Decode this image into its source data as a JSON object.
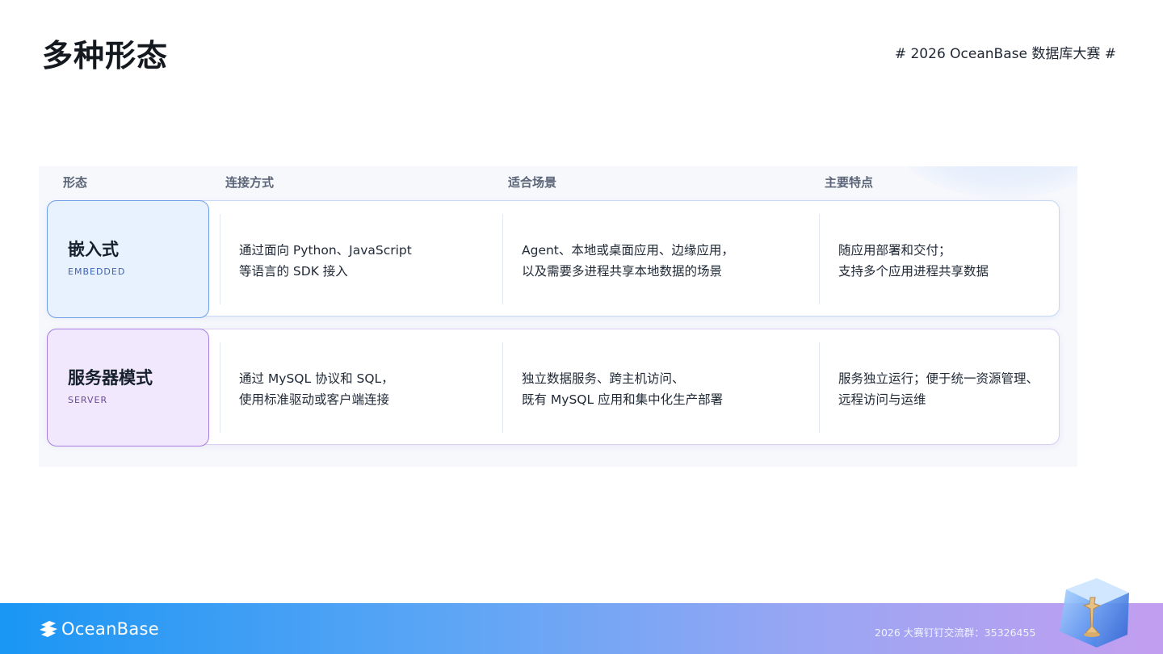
{
  "page": {
    "title": "多种形态",
    "event_tag": "# 2026 OceanBase 数据库大赛 #"
  },
  "table": {
    "headers": [
      "形态",
      "连接方式",
      "适合场景",
      "主要特点"
    ],
    "rows": [
      {
        "form": "嵌入式",
        "form_en": "EMBEDDED",
        "connection": [
          "通过面向 Python、JavaScript",
          "等语言的 SDK 接入"
        ],
        "scenario": [
          "Agent、本地或桌面应用、边缘应用，",
          "以及需要多进程共享本地数据的场景"
        ],
        "features": [
          "随应用部署和交付；",
          "支持多个应用进程共享数据"
        ]
      },
      {
        "form": "服务器模式",
        "form_en": "SERVER",
        "connection": [
          "通过 MySQL 协议和 SQL，",
          "使用标准驱动或客户端连接"
        ],
        "scenario": [
          "独立数据服务、跨主机访问、",
          "既有 MySQL 应用和集中化生产部署"
        ],
        "features": [
          "服务独立运行；便于统一资源管理、",
          "远程访问与运维"
        ]
      }
    ]
  },
  "footer": {
    "brand": "OceanBase",
    "group_info": "2026 大赛钉钉交流群：35326455",
    "logo_icon": "oceanbase-logo-icon",
    "mascot_icon": "trophy-cube-icon"
  },
  "colors": {
    "embedded_accent": "#6f9ee8",
    "server_accent": "#a67fe0",
    "footer_start": "#1a96f4",
    "footer_end": "#c39ef0"
  }
}
